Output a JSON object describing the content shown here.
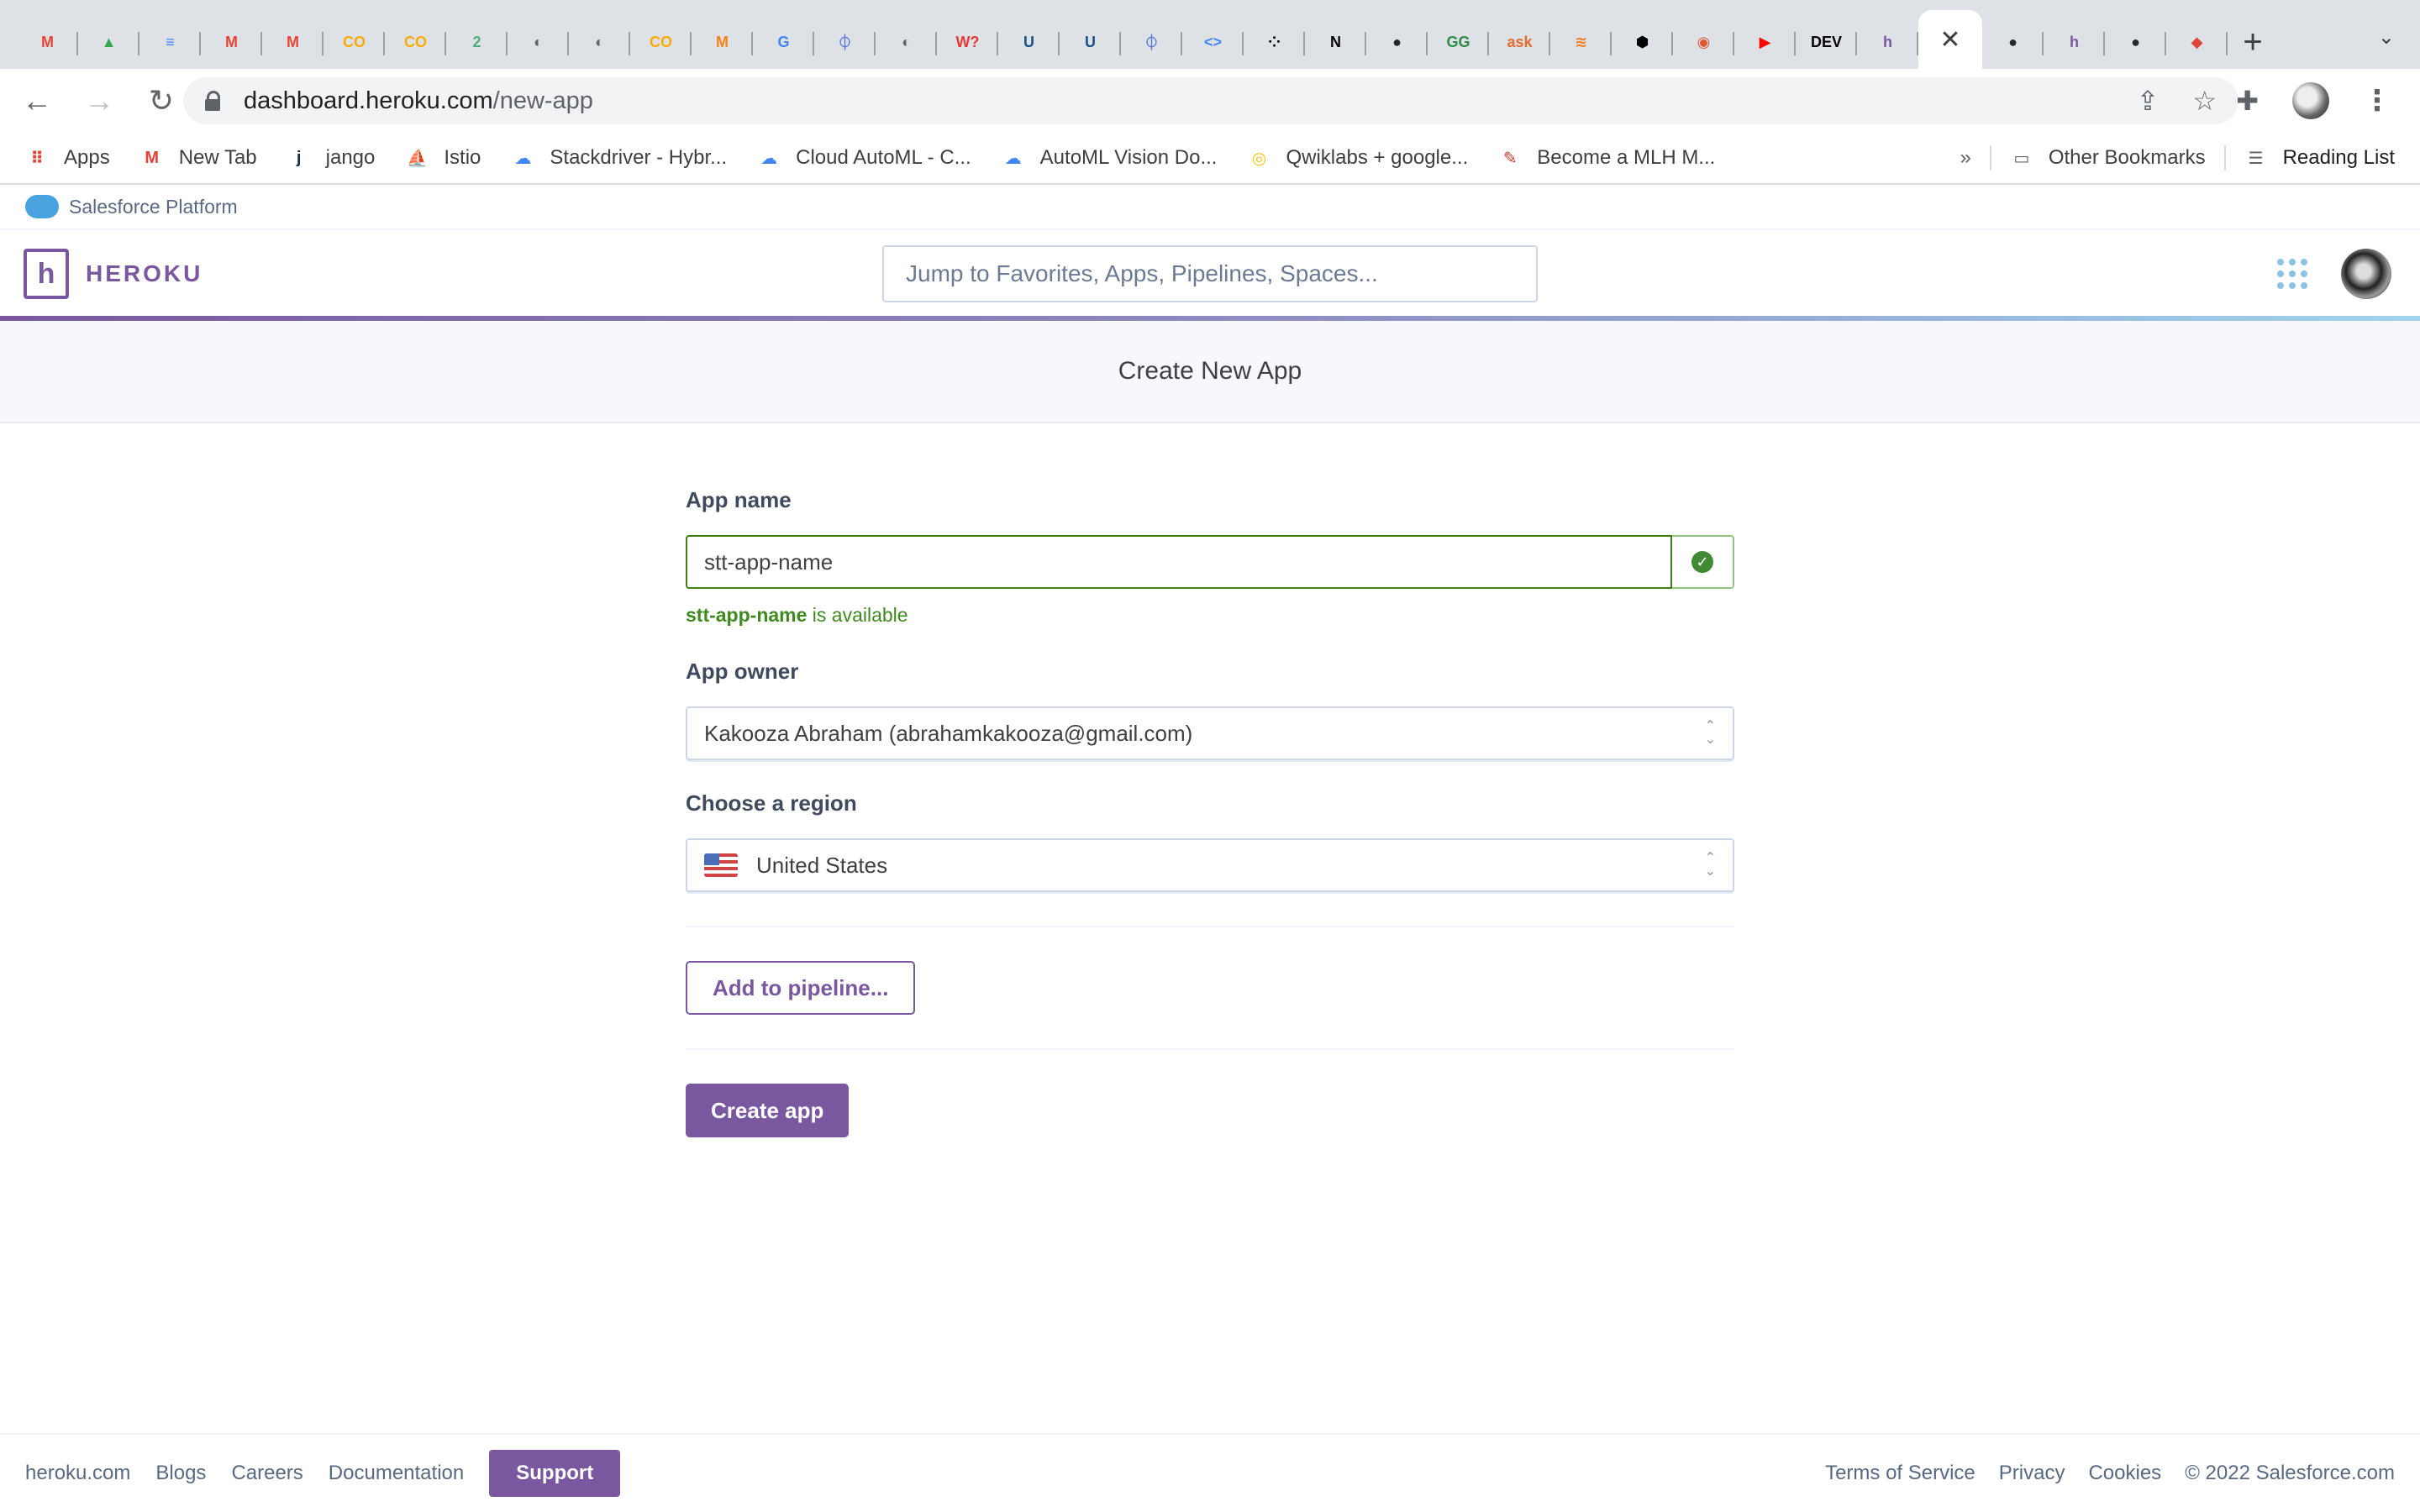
{
  "browser": {
    "tabs": [
      {
        "icon": "gmail-icon",
        "glyph": "M",
        "color": "#ea4335"
      },
      {
        "icon": "google-drive-icon",
        "glyph": "▲",
        "color": "#34a853"
      },
      {
        "icon": "google-docs-icon",
        "glyph": "≡",
        "color": "#4285f4"
      },
      {
        "icon": "gmail-icon",
        "glyph": "M",
        "color": "#ea4335"
      },
      {
        "icon": "gmail-icon",
        "glyph": "M",
        "color": "#ea4335"
      },
      {
        "icon": "colab-icon",
        "glyph": "CO",
        "color": "#f9ab00"
      },
      {
        "icon": "colab-icon",
        "glyph": "CO",
        "color": "#f9ab00"
      },
      {
        "icon": "notification-app-icon",
        "glyph": "2",
        "color": "#4caf82"
      },
      {
        "icon": "globe-icon",
        "glyph": "◐",
        "color": "#5f6368"
      },
      {
        "icon": "globe-icon",
        "glyph": "◐",
        "color": "#5f6368"
      },
      {
        "icon": "colab-icon",
        "glyph": "CO",
        "color": "#f9ab00"
      },
      {
        "icon": "moodle-icon",
        "glyph": "M",
        "color": "#f98012"
      },
      {
        "icon": "google-icon",
        "glyph": "G",
        "color": "#4285f4"
      },
      {
        "icon": "tie-icon",
        "glyph": "⏀",
        "color": "#5b7bd5"
      },
      {
        "icon": "globe-icon",
        "glyph": "◐",
        "color": "#5f6368"
      },
      {
        "icon": "w-question-icon",
        "glyph": "W?",
        "color": "#e53935"
      },
      {
        "icon": "university-icon",
        "glyph": "U",
        "color": "#1c4f8a"
      },
      {
        "icon": "university-icon",
        "glyph": "U",
        "color": "#1c4f8a"
      },
      {
        "icon": "tie-icon",
        "glyph": "⏀",
        "color": "#5b7bd5"
      },
      {
        "icon": "google-developers-icon",
        "glyph": "<>",
        "color": "#4285f4"
      },
      {
        "icon": "dots-icon",
        "glyph": "⁘",
        "color": "#000000"
      },
      {
        "icon": "notion-icon",
        "glyph": "N",
        "color": "#000000"
      },
      {
        "icon": "github-icon",
        "glyph": "●",
        "color": "#24292e"
      },
      {
        "icon": "geeksforgeeks-icon",
        "glyph": "GG",
        "color": "#2f8d46"
      },
      {
        "icon": "ask-icon",
        "glyph": "ask",
        "color": "#e46c2a"
      },
      {
        "icon": "stackoverflow-icon",
        "glyph": "≋",
        "color": "#f48024"
      },
      {
        "icon": "hexagon-icon",
        "glyph": "⬢",
        "color": "#000000"
      },
      {
        "icon": "duckduckgo-icon",
        "glyph": "◉",
        "color": "#de5833"
      },
      {
        "icon": "youtube-icon",
        "glyph": "▶",
        "color": "#ff0000"
      },
      {
        "icon": "dev-icon",
        "glyph": "DEV",
        "color": "#000000"
      },
      {
        "icon": "heroku-icon",
        "glyph": "h",
        "color": "#79589f"
      },
      {
        "icon": "active-tab-close-icon",
        "glyph": "✕",
        "color": "#3c4043",
        "active": true
      },
      {
        "icon": "github-icon",
        "glyph": "●",
        "color": "#24292e"
      },
      {
        "icon": "heroku-icon",
        "glyph": "h",
        "color": "#79589f"
      },
      {
        "icon": "github-icon",
        "glyph": "●",
        "color": "#24292e"
      },
      {
        "icon": "laravel-icon",
        "glyph": "◆",
        "color": "#e0443a"
      }
    ],
    "new_tab": "+",
    "tab_menu": "⌄",
    "url_host": "dashboard.heroku.com",
    "url_path": "/new-app",
    "bookmarks": [
      {
        "label": "Apps",
        "icon": "apps-grid-icon",
        "glyph": "⠿",
        "color": "#ea4335"
      },
      {
        "label": "New Tab",
        "icon": "gmail-icon",
        "glyph": "M",
        "color": "#ea4335"
      },
      {
        "label": "jango",
        "icon": "j-icon",
        "glyph": "j",
        "color": "#1b2d4f"
      },
      {
        "label": "Istio",
        "icon": "istio-icon",
        "glyph": "⛵",
        "color": "#466bb0"
      },
      {
        "label": "Stackdriver - Hybr...",
        "icon": "google-cloud-icon",
        "glyph": "☁",
        "color": "#4285f4"
      },
      {
        "label": "Cloud AutoML - C...",
        "icon": "google-cloud-icon",
        "glyph": "☁",
        "color": "#4285f4"
      },
      {
        "label": "AutoML Vision Do...",
        "icon": "google-cloud-icon",
        "glyph": "☁",
        "color": "#4285f4"
      },
      {
        "label": "Qwiklabs + google...",
        "icon": "qwiklabs-icon",
        "glyph": "◎",
        "color": "#f5c518"
      },
      {
        "label": "Become a MLH M...",
        "icon": "mlh-icon",
        "glyph": "✎",
        "color": "#c0392b"
      }
    ],
    "bookmarks_overflow": "»",
    "other_bookmarks": "Other Bookmarks",
    "reading_list": "Reading List"
  },
  "salesforce_bar": {
    "label": "Salesforce Platform"
  },
  "heroku": {
    "brand": "HEROKU",
    "search_placeholder": "Jump to Favorites, Apps, Pipelines, Spaces..."
  },
  "page": {
    "title": "Create New App",
    "app_name_label": "App name",
    "app_name_value": "stt-app-name",
    "availability_name": "stt-app-name",
    "availability_text": " is available",
    "app_owner_label": "App owner",
    "app_owner_value": "Kakooza Abraham (abrahamkakooza@gmail.com)",
    "region_label": "Choose a region",
    "region_value": "United States",
    "add_pipeline_label": "Add to pipeline...",
    "create_app_label": "Create app"
  },
  "footer": {
    "left_links": [
      "heroku.com",
      "Blogs",
      "Careers",
      "Documentation"
    ],
    "support": "Support",
    "right_links": [
      "Terms of Service",
      "Privacy",
      "Cookies"
    ],
    "copyright": "© 2022 Salesforce.com"
  },
  "colors": {
    "brand_purple": "#79589f",
    "success_green": "#408013"
  }
}
